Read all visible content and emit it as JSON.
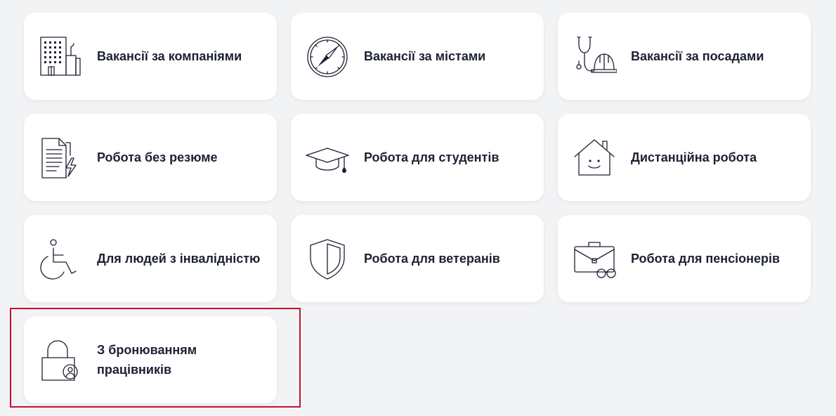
{
  "cards": [
    {
      "label": "Вакансії за компаніями",
      "icon": "office-building-icon"
    },
    {
      "label": "Вакансії за містами",
      "icon": "compass-icon"
    },
    {
      "label": "Вакансії за посадами",
      "icon": "stethoscope-hardhat-icon"
    },
    {
      "label": "Робота без резюме",
      "icon": "document-lightning-icon"
    },
    {
      "label": "Робота для студентів",
      "icon": "graduation-cap-icon"
    },
    {
      "label": "Дистанційна робота",
      "icon": "smiling-house-icon"
    },
    {
      "label": "Для людей з інвалідністю",
      "icon": "wheelchair-icon"
    },
    {
      "label": "Робота для ветеранів",
      "icon": "shield-icon"
    },
    {
      "label": "Робота для пенсіонерів",
      "icon": "briefcase-glasses-icon"
    },
    {
      "label": "З бронюванням працівників",
      "icon": "lock-person-icon"
    }
  ],
  "colors": {
    "background": "#f2f3f5",
    "card": "#ffffff",
    "text": "#1c2133",
    "highlight": "#c8102e"
  }
}
